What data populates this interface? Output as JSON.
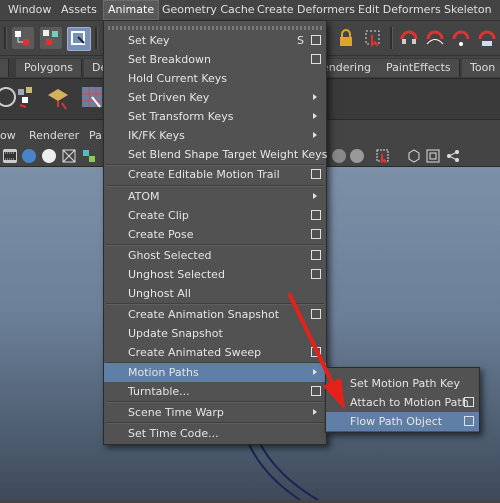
{
  "menubar": {
    "items": [
      "Window",
      "Assets",
      "Animate",
      "Geometry Cache",
      "Create Deformers",
      "Edit Deformers",
      "Skeleton"
    ]
  },
  "shelf_tabs": [
    "Polygons",
    "De",
    "endering",
    "PaintEffects",
    "Toon"
  ],
  "panel_menu": [
    "ow",
    "Renderer",
    "Pa"
  ],
  "animate_menu": {
    "items": [
      {
        "label": "Set Key",
        "shortcut": "S",
        "option_box": true
      },
      {
        "label": "Set Breakdown",
        "option_box": true
      },
      {
        "label": "Hold Current Keys"
      },
      {
        "label": "Set Driven Key",
        "submenu": true
      },
      {
        "label": "Set Transform Keys",
        "submenu": true
      },
      {
        "label": "IK/FK Keys",
        "submenu": true
      },
      {
        "label": "Set Blend Shape Target Weight Keys"
      },
      {
        "label": "Create Editable Motion Trail",
        "option_box": true
      },
      {
        "label": "ATOM",
        "submenu": true
      },
      {
        "label": "Create Clip",
        "option_box": true
      },
      {
        "label": "Create Pose",
        "option_box": true
      },
      {
        "label": "Ghost Selected",
        "option_box": true
      },
      {
        "label": "Unghost Selected",
        "option_box": true
      },
      {
        "label": "Unghost All"
      },
      {
        "label": "Create Animation Snapshot",
        "option_box": true
      },
      {
        "label": "Update Snapshot"
      },
      {
        "label": "Create Animated Sweep",
        "option_box": true
      },
      {
        "label": "Motion Paths",
        "submenu": true,
        "highlighted": true
      },
      {
        "label": "Turntable...",
        "option_box": true
      },
      {
        "label": "Scene Time Warp",
        "submenu": true
      },
      {
        "label": "Set Time Code..."
      }
    ]
  },
  "motion_paths_submenu": {
    "items": [
      {
        "label": "Set Motion Path Key"
      },
      {
        "label": "Attach to Motion Path",
        "option_box": true
      },
      {
        "label": "Flow Path Object",
        "option_box": true,
        "highlighted": true
      }
    ]
  },
  "colors": {
    "highlight": "#5f7fa6",
    "menu_bg": "#525252",
    "annotation_arrow": "#e8201a"
  }
}
